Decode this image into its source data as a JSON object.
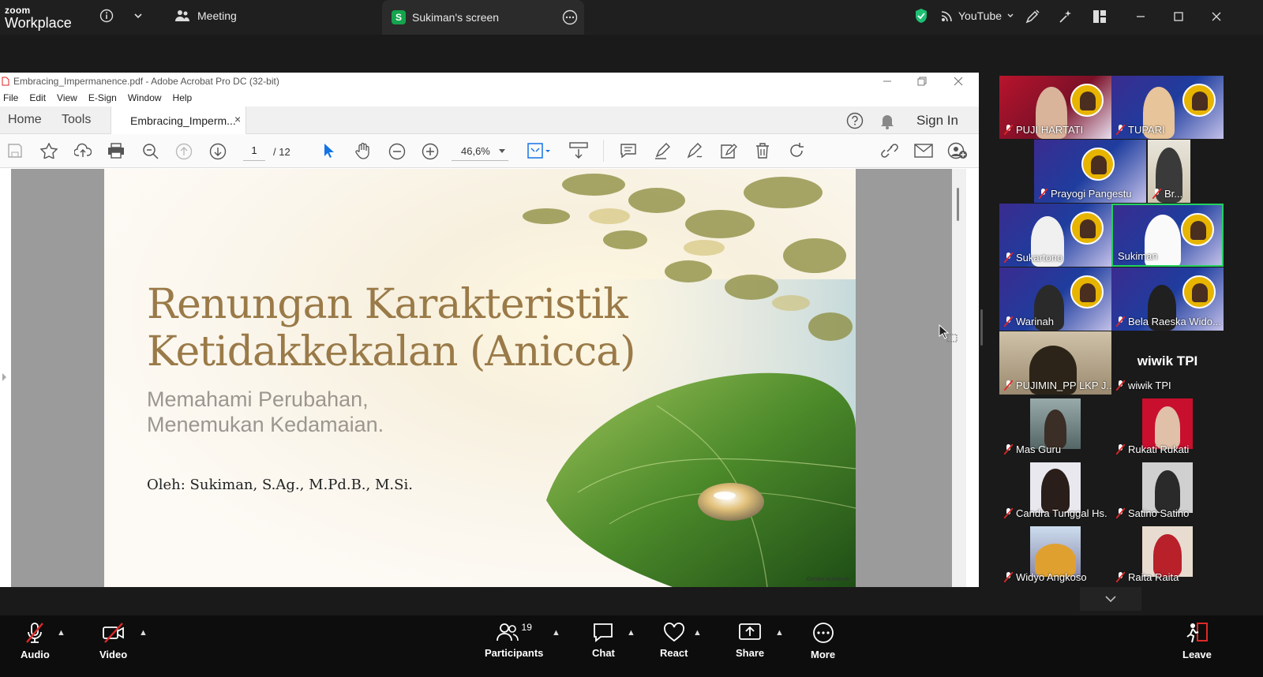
{
  "app": {
    "logo_top": "zoom",
    "logo_bottom": "Workplace"
  },
  "topbar": {
    "meeting_tab": "Meeting",
    "screen_tab_badge": "S",
    "screen_tab": "Sukiman's screen",
    "youtube": "YouTube",
    "shield_color": "#1dbf73",
    "accent_green": "#14a44d"
  },
  "acrobat": {
    "window_title": "Embracing_Impermanence.pdf - Adobe Acrobat Pro DC (32-bit)",
    "menu": [
      "File",
      "Edit",
      "View",
      "E-Sign",
      "Window",
      "Help"
    ],
    "tabs": {
      "home": "Home",
      "tools": "Tools",
      "doc": "Embracing_Imperm...",
      "close": "×"
    },
    "sign_in": "Sign In",
    "page_current": "1",
    "page_total": "/ 12",
    "zoom": "46,6%"
  },
  "slide": {
    "title_line1": "Renungan Karakteristik",
    "title_line2": "Ketidakkekalan (Anicca)",
    "subtitle_line1": "Memahami Perubahan,",
    "subtitle_line2": "Menemukan Kedamaian.",
    "author": "Oleh: Sukiman, S.Ag., M.Pd.B., M.Si.",
    "watermark": "Gemini Notebook"
  },
  "participants": [
    {
      "name": "PUJI HARTATI"
    },
    {
      "name": "TUPARI"
    },
    {
      "name": "Prayogi Pangestu"
    },
    {
      "name": "Br..."
    },
    {
      "name": "Sukartono"
    },
    {
      "name": "Sukiman"
    },
    {
      "name": "Warinah"
    },
    {
      "name": "Bela Raeska Wido..."
    },
    {
      "name": "PUJIMIN_PP LKP J..."
    },
    {
      "name": "wiwik TPI",
      "big": "wiwik TPI"
    },
    {
      "name": "Mas Guru"
    },
    {
      "name": "Rukati Rukati"
    },
    {
      "name": "Candra Tunggal Hs."
    },
    {
      "name": "Satino Satino"
    },
    {
      "name": "Widyo Angkoso"
    },
    {
      "name": "Raita Raita"
    }
  ],
  "bottombar": {
    "audio": "Audio",
    "video": "Video",
    "participants": "Participants",
    "participants_count": "19",
    "chat": "Chat",
    "react": "React",
    "share": "Share",
    "more": "More",
    "leave": "Leave",
    "muted_color": "#e02828"
  }
}
